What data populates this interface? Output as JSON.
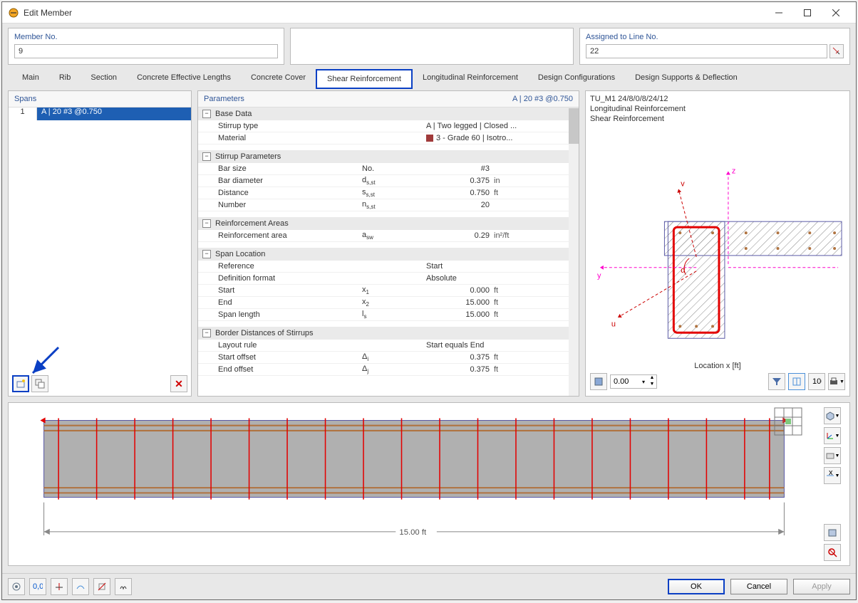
{
  "window": {
    "title": "Edit Member"
  },
  "header": {
    "member_no_label": "Member No.",
    "member_no_value": "9",
    "assigned_label": "Assigned to Line No.",
    "assigned_value": "22"
  },
  "tabs": [
    "Main",
    "Rib",
    "Section",
    "Concrete Effective Lengths",
    "Concrete Cover",
    "Shear Reinforcement",
    "Longitudinal Reinforcement",
    "Design Configurations",
    "Design Supports & Deflection"
  ],
  "active_tab": "Shear Reinforcement",
  "spans": {
    "title": "Spans",
    "rows": [
      {
        "num": "1",
        "label": "A | 20 #3 @0.750"
      }
    ]
  },
  "params": {
    "title": "Parameters",
    "subtitle": "A | 20 #3 @0.750",
    "groups": {
      "base": {
        "title": "Base Data",
        "stirrup_type_label": "Stirrup type",
        "stirrup_type_value": "A | Two legged | Closed ...",
        "material_label": "Material",
        "material_value": "3 - Grade 60 | Isotro..."
      },
      "stirrup": {
        "title": "Stirrup Parameters",
        "bar_size_label": "Bar size",
        "bar_size_sym": "No.",
        "bar_size_val": "#3",
        "bar_dia_label": "Bar diameter",
        "bar_dia_sym": "d",
        "bar_dia_val": "0.375",
        "bar_dia_unit": "in",
        "distance_label": "Distance",
        "distance_sym": "s",
        "distance_val": "0.750",
        "distance_unit": "ft",
        "number_label": "Number",
        "number_sym": "n",
        "number_val": "20"
      },
      "reinf": {
        "title": "Reinforcement Areas",
        "area_label": "Reinforcement area",
        "area_sym": "a",
        "area_val": "0.29",
        "area_unit": "in²/ft"
      },
      "span": {
        "title": "Span Location",
        "ref_label": "Reference",
        "ref_val": "Start",
        "def_label": "Definition format",
        "def_val": "Absolute",
        "start_label": "Start",
        "start_sym": "x",
        "start_val": "0.000",
        "start_unit": "ft",
        "end_label": "End",
        "end_sym": "x",
        "end_val": "15.000",
        "end_unit": "ft",
        "len_label": "Span length",
        "len_sym": "l",
        "len_val": "15.000",
        "len_unit": "ft"
      },
      "border": {
        "title": "Border Distances of Stirrups",
        "rule_label": "Layout rule",
        "rule_val": "Start equals End",
        "startoff_label": "Start offset",
        "startoff_sym": "Δ",
        "startoff_val": "0.375",
        "startoff_unit": "ft",
        "endoff_label": "End offset",
        "endoff_sym": "Δ",
        "endoff_val": "0.375",
        "endoff_unit": "ft"
      }
    }
  },
  "preview": {
    "line1": "TU_M1 24/8/0/8/24/12",
    "line2": "Longitudinal Reinforcement",
    "line3": "Shear Reinforcement",
    "axes": {
      "z": "z",
      "y": "y",
      "u": "u",
      "v": "v",
      "alpha": "α"
    },
    "location_label": "Location x [ft]",
    "location_value": "0.00"
  },
  "longview": {
    "length_label": "15.00 ft"
  },
  "footer": {
    "ok": "OK",
    "cancel": "Cancel",
    "apply": "Apply"
  }
}
